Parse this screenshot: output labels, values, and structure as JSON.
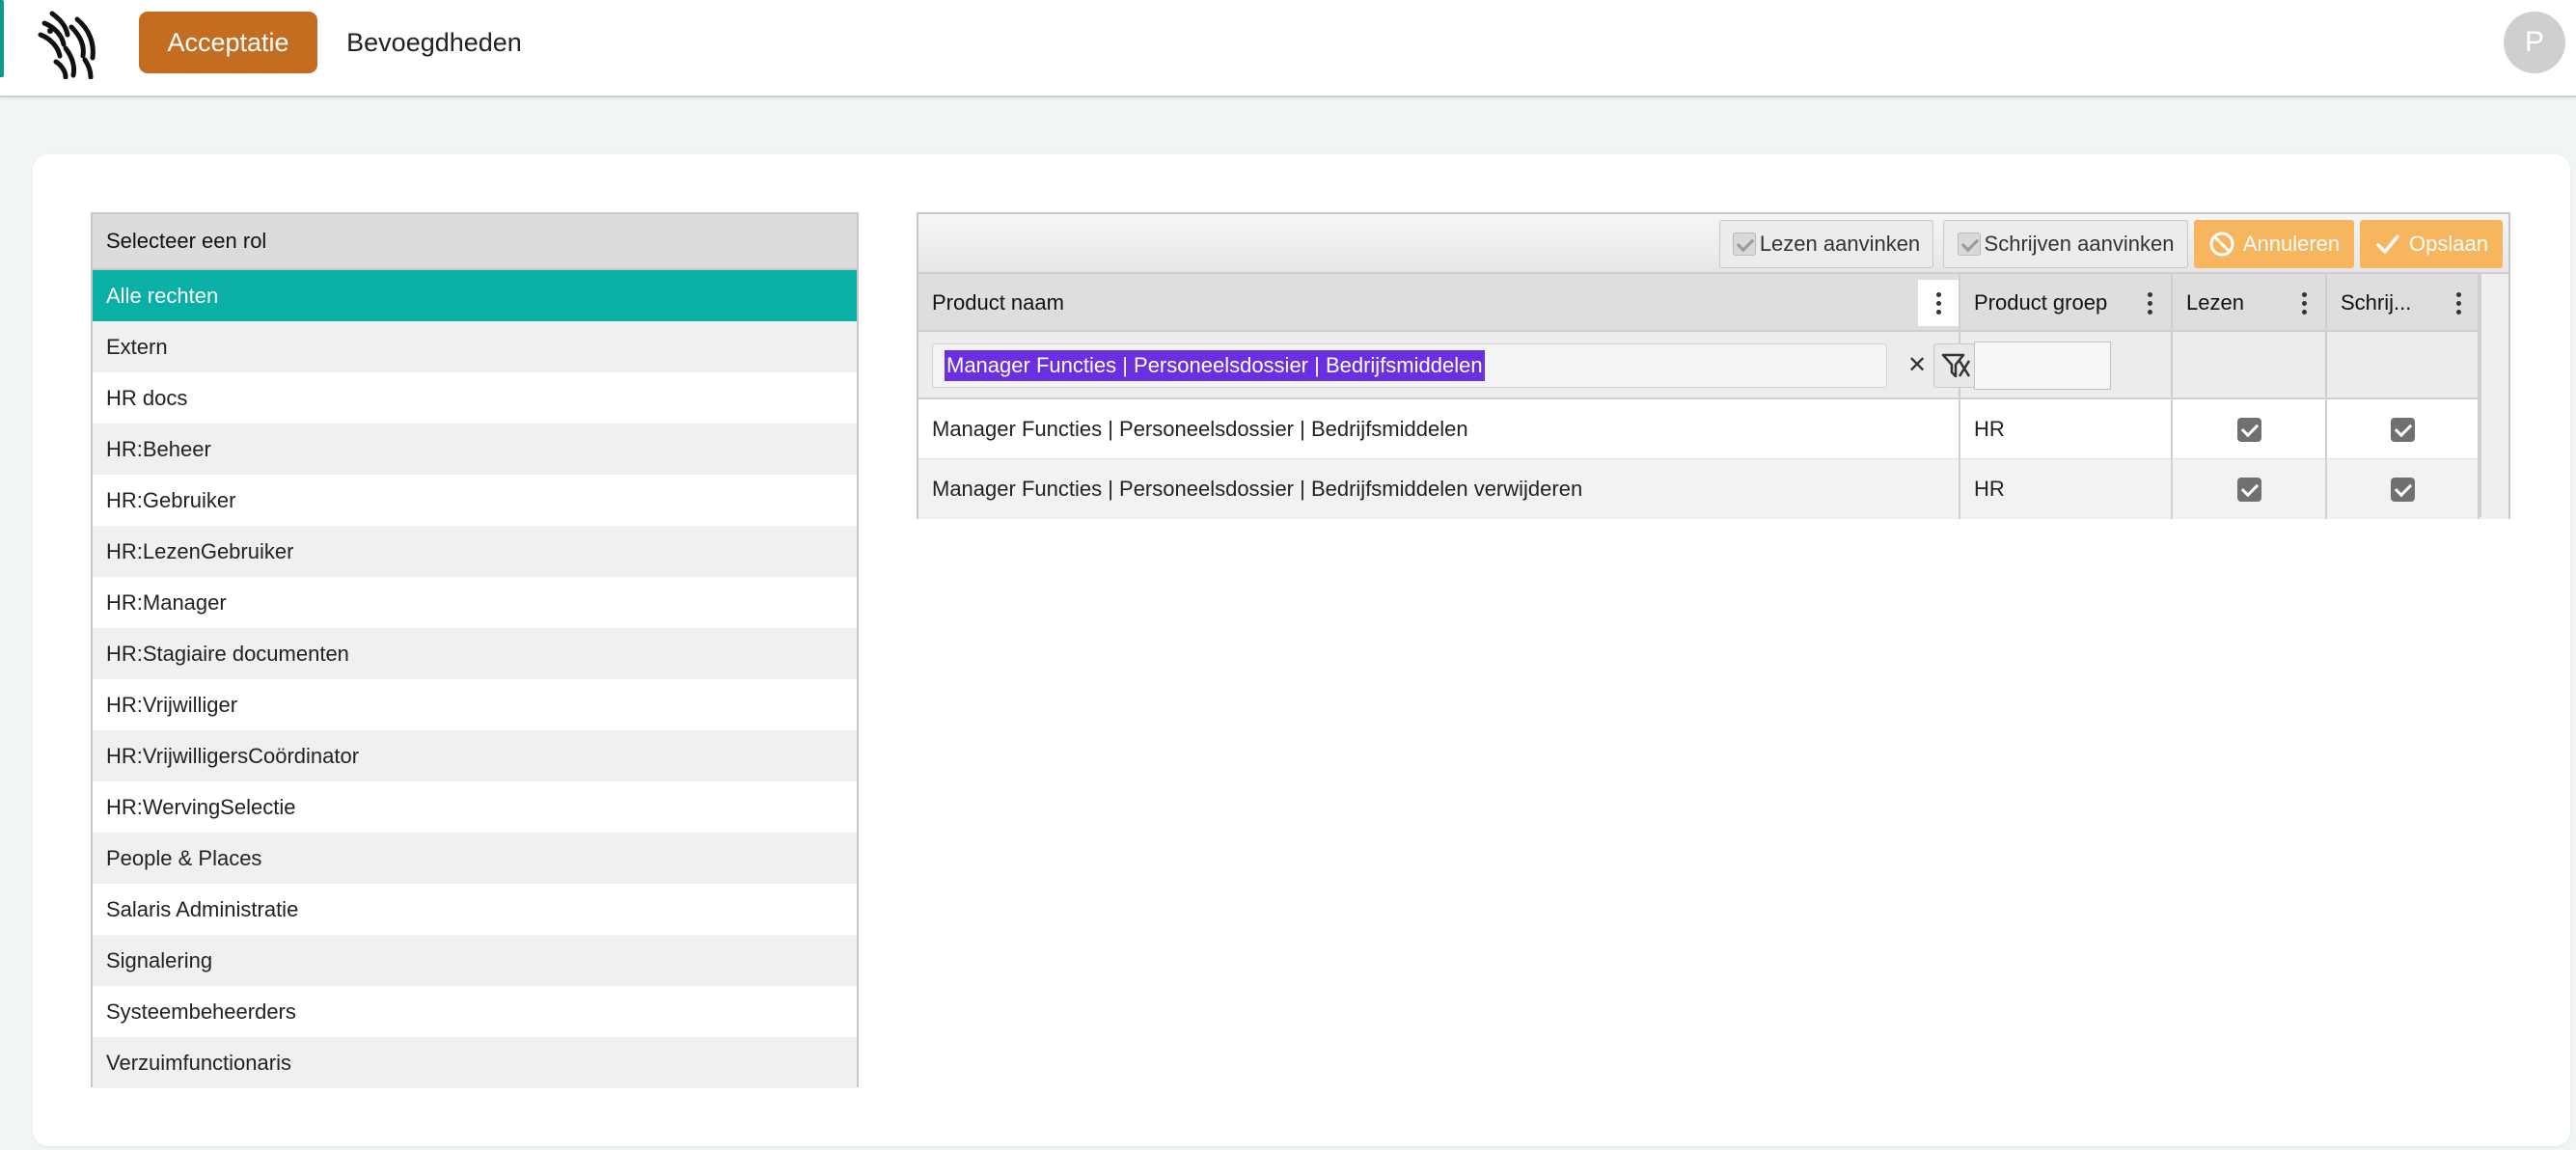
{
  "nav": {
    "tabs": [
      {
        "label": "Acceptatie",
        "active": true
      },
      {
        "label": "Bevoegdheden",
        "active": false
      }
    ],
    "avatar_initial": "P"
  },
  "roles": {
    "header": "Selecteer een rol",
    "items": [
      "Alle rechten",
      "Extern",
      "HR docs",
      "HR:Beheer",
      "HR:Gebruiker",
      "HR:LezenGebruiker",
      "HR:Manager",
      "HR:Stagiaire documenten",
      "HR:Vrijwilliger",
      "HR:VrijwilligersCoördinator",
      "HR:WervingSelectie",
      "People & Places",
      "Salaris Administratie",
      "Signalering",
      "Systeembeheerders",
      "Verzuimfunctionaris"
    ],
    "selected_index": 0
  },
  "toolbar": {
    "lezen_label": "Lezen aanvinken",
    "schrijven_label": "Schrijven aanvinken",
    "cancel_label": "Annuleren",
    "save_label": "Opslaan"
  },
  "grid": {
    "columns": [
      "Product naam",
      "Product groep",
      "Lezen",
      "Schrij..."
    ],
    "filter_value": "Manager Functies | Personeelsdossier | Bedrijfsmiddelen",
    "rows": [
      {
        "name": "Manager Functies | Personeelsdossier | Bedrijfsmiddelen",
        "group": "HR",
        "lezen": true,
        "schrijven": true
      },
      {
        "name": "Manager Functies | Personeelsdossier | Bedrijfsmiddelen verwijderen",
        "group": "HR",
        "lezen": true,
        "schrijven": true
      }
    ]
  },
  "colors": {
    "brand_orange": "#c46c1f",
    "accent_teal": "#0aafa6",
    "button_orange": "#f7b55d",
    "selection_purple": "#6a2fe0"
  }
}
